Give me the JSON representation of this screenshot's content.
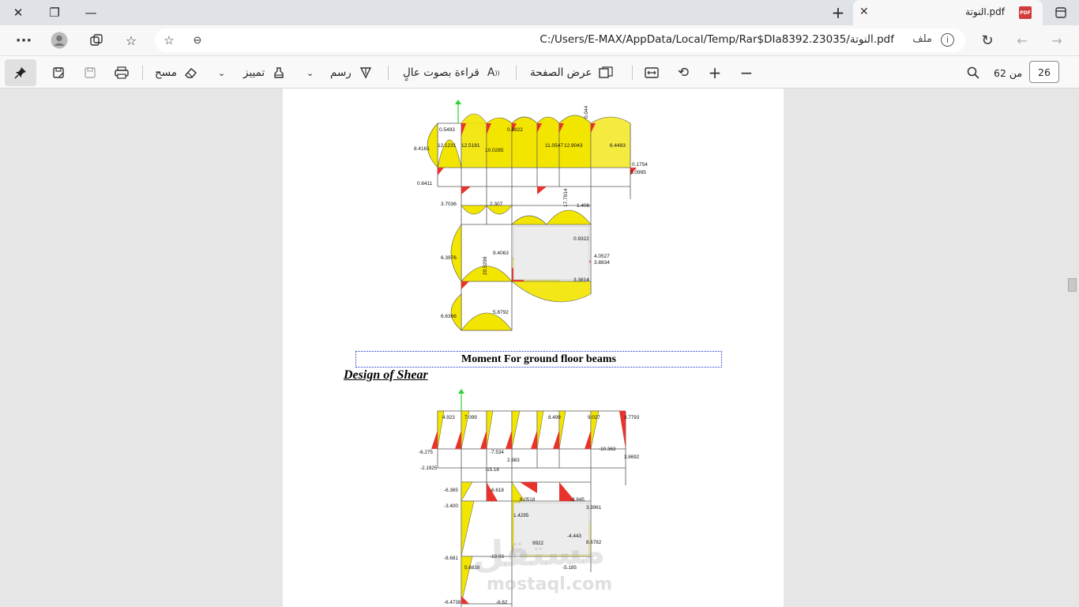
{
  "window": {
    "tab_title": "النوتة.pdf",
    "tab_pdf_badge": "PDF"
  },
  "address": {
    "file_label": "ملف",
    "url": "C:/Users/E-MAX/AppData/Local/Temp/Rar$DIa8392.23035/النوتة.pdf"
  },
  "toolbar": {
    "erase_label": "مسح",
    "highlight_label": "تمييز",
    "draw_label": "رسم",
    "read_aloud_label": "قراءة بصوت عالٍ",
    "page_view_label": "عرض الصفحة",
    "page_total_label": "من 62",
    "page_number": "26"
  },
  "document": {
    "caption": "Moment For ground floor beams",
    "section_heading": "Design of Shear",
    "watermark": "مستقل",
    "watermark_sub": "mostaql.com"
  },
  "moment_labels": [
    "8.4161",
    "12.1231",
    "12.5181",
    "10.0285",
    "11.0547",
    "12.9043",
    "6.4483",
    "0.6411",
    "3.7036",
    "2.307",
    "17.7914",
    "1.406",
    "6.3976",
    "9.4063",
    "20.5299",
    "0.9322",
    "4.0527",
    "3.8834",
    "3.3814",
    "6.6366",
    "5.8792",
    "0.5493",
    "0.8822",
    "0.044",
    "0.1754",
    "5.0995"
  ],
  "shear_labels": [
    "4.923",
    "7.099",
    "8.499",
    "9.027",
    "3.7793",
    "-6.275",
    "-2.1925",
    "-10.363",
    "3.8692",
    "-6.365",
    "-3.400",
    "-15.18",
    "-6.618",
    "-3.845",
    "3.3961",
    "-4.443",
    "8.6782",
    "-8.681",
    "5.6838",
    "-19.03",
    "-5.185",
    "-6.4738",
    "-6.62",
    "-7.534",
    "2.983",
    "8.0518",
    "1.4295",
    "9922"
  ]
}
